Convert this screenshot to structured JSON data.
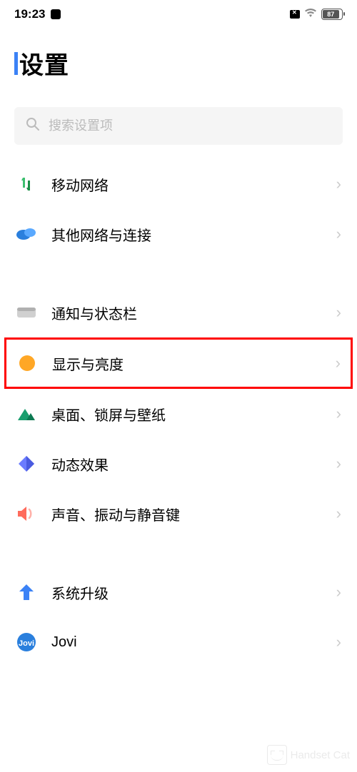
{
  "status": {
    "time": "19:23",
    "battery": "87"
  },
  "page": {
    "title": "设置"
  },
  "search": {
    "placeholder": "搜索设置项"
  },
  "items": {
    "mobile_network": "移动网络",
    "other_connections": "其他网络与连接",
    "notification_status": "通知与状态栏",
    "display_brightness": "显示与亮度",
    "desktop_lock_wallpaper": "桌面、锁屏与壁纸",
    "dynamic_effects": "动态效果",
    "sound_vibration": "声音、振动与静音键",
    "system_upgrade": "系统升级",
    "jovi": "Jovi"
  },
  "watermark": "Handset Cat"
}
